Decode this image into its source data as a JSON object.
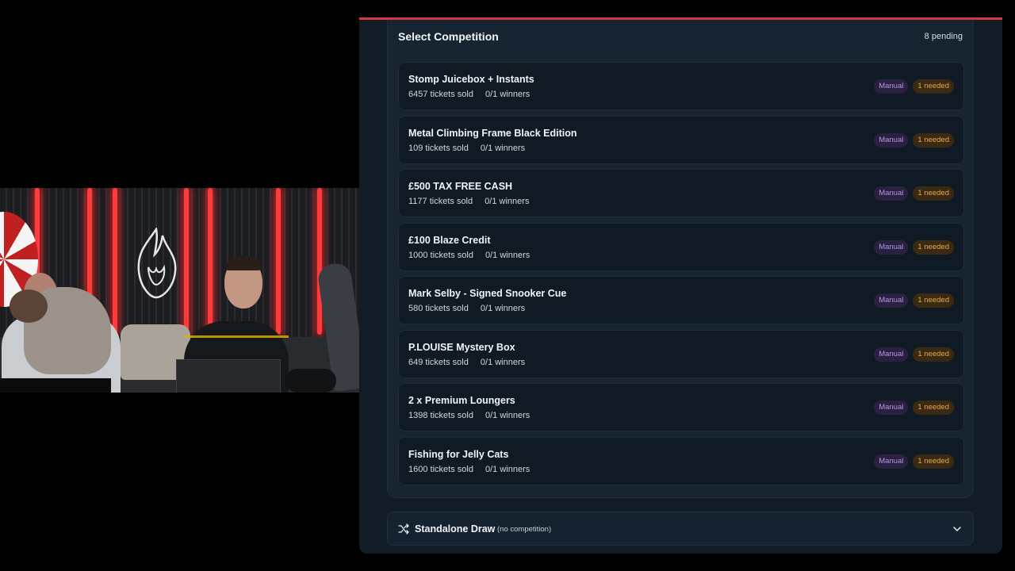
{
  "panel": {
    "title": "Select Competition",
    "pending": "8 pending",
    "competitions": [
      {
        "name": "Stomp Juicebox + Instants",
        "tickets": "6457 tickets sold",
        "winners": "0/1 winners",
        "type": "Manual",
        "needed": "1 needed"
      },
      {
        "name": "Metal Climbing Frame Black Edition",
        "tickets": "109 tickets sold",
        "winners": "0/1 winners",
        "type": "Manual",
        "needed": "1 needed"
      },
      {
        "name": "£500 TAX FREE CASH",
        "tickets": "1177 tickets sold",
        "winners": "0/1 winners",
        "type": "Manual",
        "needed": "1 needed"
      },
      {
        "name": "£100 Blaze Credit",
        "tickets": "1000 tickets sold",
        "winners": "0/1 winners",
        "type": "Manual",
        "needed": "1 needed"
      },
      {
        "name": "Mark Selby - Signed Snooker Cue",
        "tickets": "580 tickets sold",
        "winners": "0/1 winners",
        "type": "Manual",
        "needed": "1 needed"
      },
      {
        "name": "P.LOUISE Mystery Box",
        "tickets": "649 tickets sold",
        "winners": "0/1 winners",
        "type": "Manual",
        "needed": "1 needed"
      },
      {
        "name": "2 x Premium Loungers",
        "tickets": "1398 tickets sold",
        "winners": "0/1 winners",
        "type": "Manual",
        "needed": "1 needed"
      },
      {
        "name": "Fishing for Jelly Cats",
        "tickets": "1600 tickets sold",
        "winners": "0/1 winners",
        "type": "Manual",
        "needed": "1 needed"
      }
    ],
    "standalone": {
      "label": "Standalone Draw",
      "sublabel": "(no competition)",
      "icon": "shuffle-icon"
    }
  },
  "colors": {
    "accent": "#d2393c",
    "manual_badge": "#b596e8",
    "needed_badge": "#e8a845"
  }
}
